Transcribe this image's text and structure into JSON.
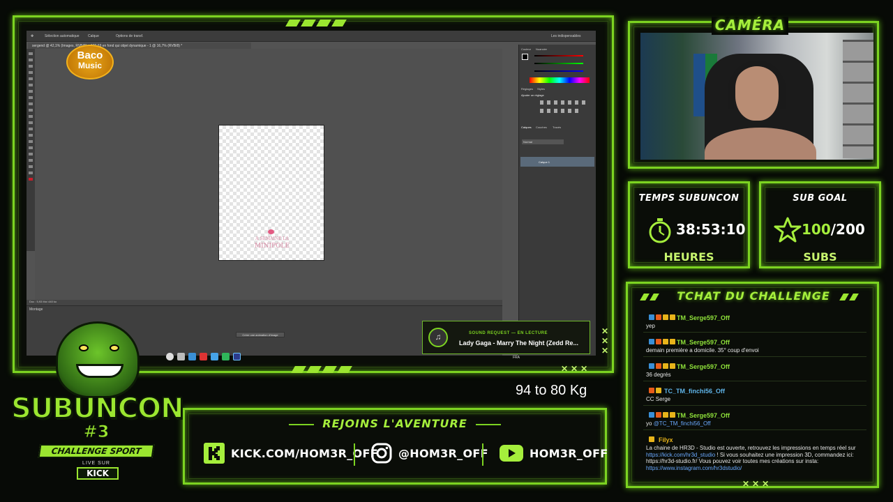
{
  "screen": {
    "ps_options": {
      "opt1": "Sélection automatique",
      "opt2": "Calque",
      "opt3": "Options de transf.",
      "workspace": "Les indispensables"
    },
    "doc_tab": "sergend @ 42,1% (Images, RVB/8) × 123.69 en fond qui objet dynamique - 1 @ 16,7% (RVB/8) *",
    "doc_logo_line1": "A SEMAINE LA",
    "doc_logo_line2": "MINIPOLE",
    "status_text": "Doc : 5,93 Mo/ 440 ko",
    "timeline_label": "Montage",
    "timeline_button": "Créer une animation d'image",
    "panel_color": "Couleur",
    "panel_swatches": "Nuancier",
    "panel_adjust": "Réglages",
    "panel_styles": "Styles",
    "panel_add_adjust": "Ajouter un réglage",
    "panel_layers": "Calques",
    "panel_channels": "Couches",
    "panel_paths": "Tracés",
    "blend_mode": "Normal",
    "layer_name": "Calque 1",
    "tray_text": "FRA"
  },
  "baco_logo": {
    "line1": "Baco",
    "line2": "Music"
  },
  "sound_request": {
    "kicker": "SOUND REQUEST — EN LECTURE",
    "track": "Lady Gaga - Marry The Night (Zedd Re..."
  },
  "camera": {
    "title": "CAMÉRA"
  },
  "timer": {
    "label": "TEMPS SUBUNCON",
    "value": "38:53:10",
    "unit": "HEURES"
  },
  "goal": {
    "label": "SUB GOAL",
    "current": "100",
    "target": "/200",
    "unit": "SUBS",
    "progress": 0.5
  },
  "chat": {
    "title": "TCHAT DU CHALLENGE",
    "messages": [
      {
        "user": "TM_Serge597_Off",
        "text": "yep"
      },
      {
        "user": "TM_Serge597_Off",
        "text": "demain première a domicile. 35° coup d'envoi"
      },
      {
        "user": "TM_Serge597_Off",
        "text": "36 degrés"
      },
      {
        "user": "TC_TM_finchi56_Off",
        "text": "CC Serge"
      },
      {
        "user": "TM_Serge597_Off",
        "text": "yo",
        "mention": "@TC_TM_finchi56_Off"
      },
      {
        "user": "Filyx",
        "text1": "La chaine de HR3D - Studio est ouverte, retrouvez les impressions en temps réel sur",
        "link1": "https://kick.com/hr3d_studio",
        "text2": "! Si vous souhaitez une impression 3D, commandez ici: https://hr3d-studio.fr/ Vous pouvez voir toutes mes créations sur insta:",
        "link2": "https://www.instagram.com/hr3dstudio/"
      }
    ]
  },
  "weight": {
    "text": "94 to 80 Kg"
  },
  "social": {
    "title": "REJOINS L'AVENTURE",
    "kick": "KICK.COM/HOM3R_OFF",
    "instagram": "@HOM3R_OFF",
    "youtube": "HOM3R_OFF"
  },
  "logo": {
    "name": "SUBUNCON",
    "number": "#3",
    "banner": "CHALLENGE SPORT",
    "live": "LIVE SUR",
    "kick": "KICK"
  },
  "colors": {
    "accent": "#7cd321",
    "accent_light": "#a5ee3c",
    "background": "#070a06",
    "link": "#6aa9ff"
  }
}
